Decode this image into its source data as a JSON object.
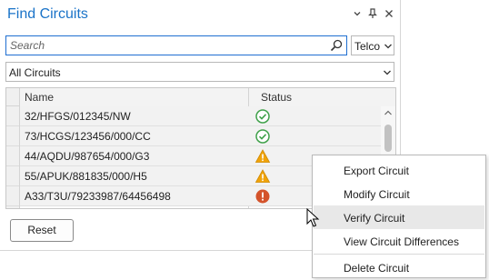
{
  "window": {
    "title": "Find Circuits",
    "icons": [
      "chevron-down-icon",
      "pin-icon",
      "close-icon"
    ]
  },
  "search": {
    "placeholder": "Search",
    "value": "",
    "category_selected": "Telco",
    "filter_selected": "All Circuits"
  },
  "grid": {
    "columns": [
      "Name",
      "Status"
    ],
    "rows": [
      {
        "name": "32/HFGS/012345/NW",
        "status": "ok"
      },
      {
        "name": "73/HCGS/123456/000/CC",
        "status": "ok"
      },
      {
        "name": "44/AQDU/987654/000/G3",
        "status": "warning"
      },
      {
        "name": "55/APUK/881835/000/H5",
        "status": "warning"
      },
      {
        "name": "A33/T3U/79233987/64456498",
        "status": "error"
      }
    ],
    "status_colors": {
      "ok": "#3fa14a",
      "warning": "#f0a30a",
      "error": "#d4532b"
    }
  },
  "buttons": {
    "reset": "Reset"
  },
  "context_menu": {
    "items": [
      {
        "label": "Export Circuit",
        "hover": false
      },
      {
        "label": "Modify Circuit",
        "hover": false
      },
      {
        "label": "Verify Circuit",
        "hover": true
      },
      {
        "label": "View Circuit Differences",
        "hover": false
      },
      {
        "label": "Delete Circuit",
        "hover": false
      }
    ]
  },
  "colors": {
    "accent": "#1a73c8"
  }
}
